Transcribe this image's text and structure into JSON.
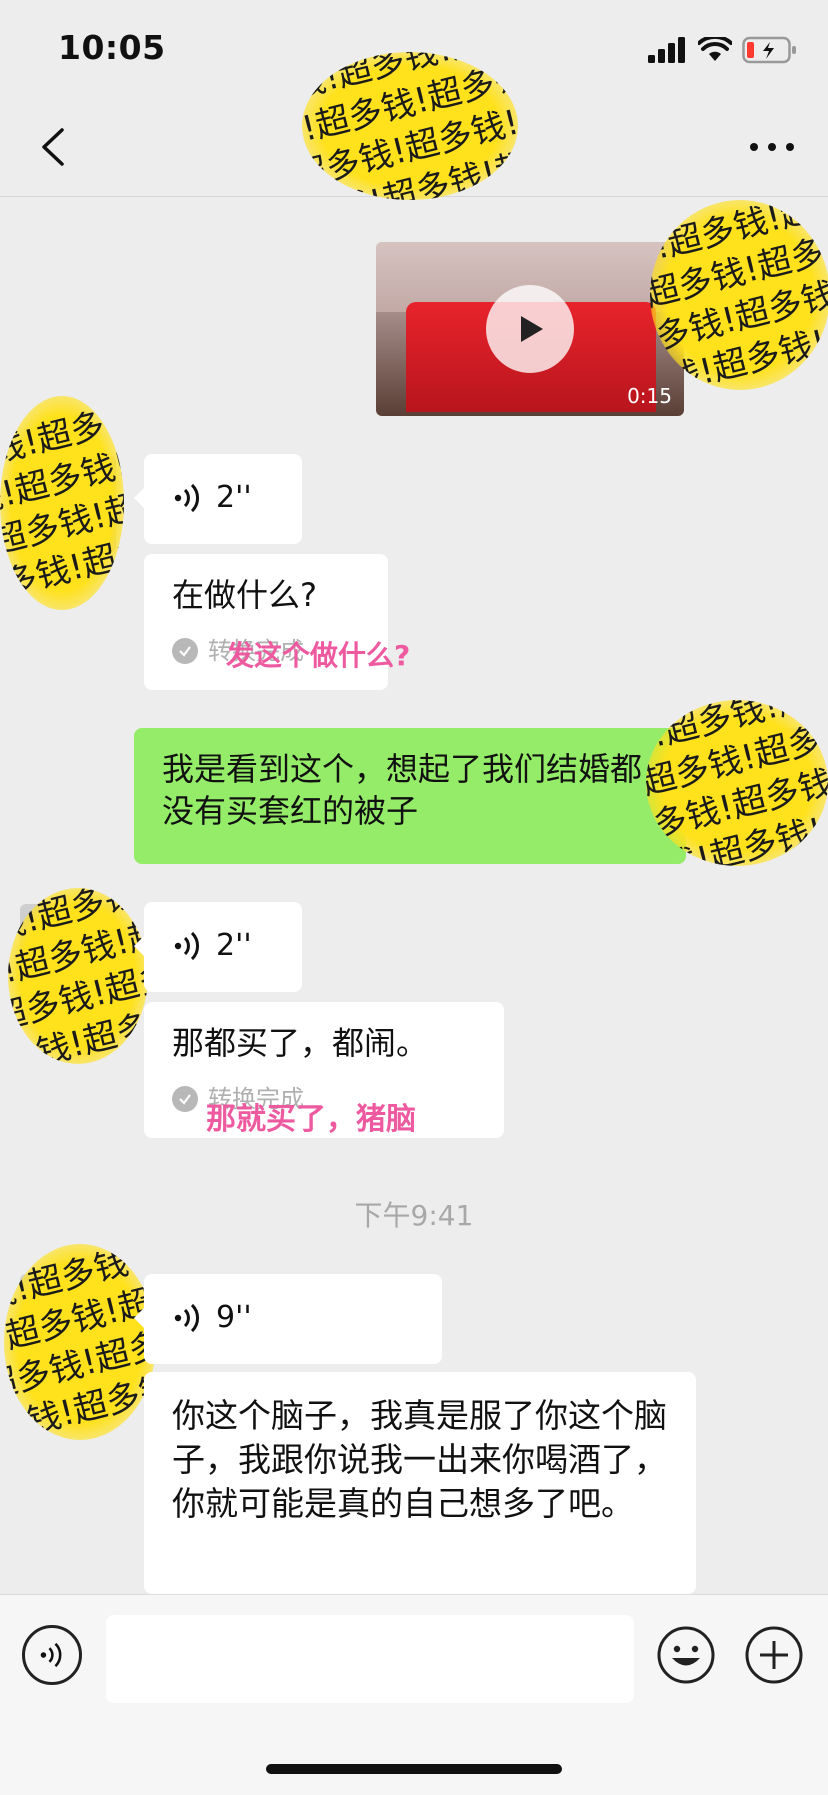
{
  "status_bar": {
    "time": "10:05"
  },
  "stickers": {
    "text": "超多钱!超多钱!超多钱!\n多钱!超多钱!超多钱!超\n钱!超多钱!超多钱!超多\n!超多钱!超多钱!超多钱"
  },
  "messages": [
    {
      "type": "video",
      "side": "right",
      "duration": "0:15"
    },
    {
      "type": "voice",
      "side": "left",
      "duration": "2''"
    },
    {
      "type": "voice_text",
      "side": "left",
      "text": "在做什么?",
      "status": "转换完成",
      "overlay": "发这个做什么?"
    },
    {
      "type": "text",
      "side": "right",
      "text": "我是看到这个，想起了我们结婚都没有买套红的被子"
    },
    {
      "type": "voice",
      "side": "left",
      "duration": "2''"
    },
    {
      "type": "voice_text",
      "side": "left",
      "text": "那都买了，都闹。",
      "status": "转换完成",
      "overlay": "那就买了，猪脑"
    },
    {
      "type": "voice",
      "side": "left",
      "duration": "9''"
    },
    {
      "type": "voice_text",
      "side": "left",
      "text": "你这个脑子，我真是服了你这个脑子，我跟你说我一出来你喝酒了，你就可能是真的自己想多了吧。"
    }
  ],
  "timestamp": "下午9:41",
  "colors": {
    "green_bubble": "#95ec69",
    "pink_overlay": "#ee5aa0",
    "sticker_yellow": "#ffe11c"
  },
  "icons": [
    "back-icon",
    "more-icon",
    "play-icon",
    "voice-wave-icon",
    "check-icon",
    "emoji-icon",
    "plus-icon",
    "signal-icon",
    "wifi-icon",
    "battery-icon"
  ]
}
